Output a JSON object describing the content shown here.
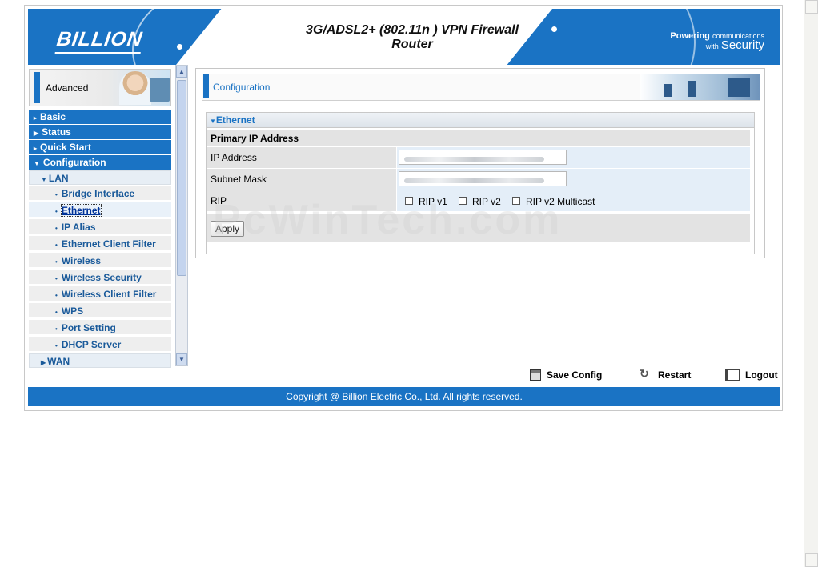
{
  "header": {
    "logo": "BILLION",
    "title_line1": "3G/ADSL2+ (802.11n ) VPN Firewall",
    "title_line2": "Router",
    "tagline_main": "Powering",
    "tagline_small": "communications",
    "tagline_with": "with",
    "tagline_big": "Security"
  },
  "sidebar": {
    "mode_label": "Advanced",
    "menu": [
      {
        "label": "Basic",
        "kind": "top"
      },
      {
        "label": "Status",
        "kind": "top"
      },
      {
        "label": "Quick Start",
        "kind": "top"
      },
      {
        "label": "Configuration",
        "kind": "top-open"
      }
    ],
    "lan_label": "LAN",
    "lan_items": [
      "Bridge Interface",
      "Ethernet",
      "IP Alias",
      "Ethernet Client Filter",
      "Wireless",
      "Wireless Security",
      "Wireless Client Filter",
      "WPS",
      "Port Setting",
      "DHCP Server"
    ],
    "active_item": "Ethernet",
    "wan_label": "WAN"
  },
  "main": {
    "section_title": "Configuration",
    "panel_title": "Ethernet",
    "group_title": "Primary IP Address",
    "fields": {
      "ip_label": "IP Address",
      "subnet_label": "Subnet Mask",
      "rip_label": "RIP"
    },
    "rip_options": [
      "RIP v1",
      "RIP v2",
      "RIP v2 Multicast"
    ],
    "apply_label": "Apply"
  },
  "actions": {
    "save": "Save Config",
    "restart": "Restart",
    "logout": "Logout"
  },
  "footer": {
    "copyright": "Copyright @ Billion Electric Co., Ltd. All rights reserved."
  },
  "watermark": "PcWinTech.com",
  "icons": [
    "save-icon",
    "restart-icon",
    "logout-icon",
    "arrow-right-icon",
    "arrow-down-icon"
  ],
  "colors": {
    "brand_blue": "#1a73c4",
    "link_blue": "#1a5a9a"
  }
}
